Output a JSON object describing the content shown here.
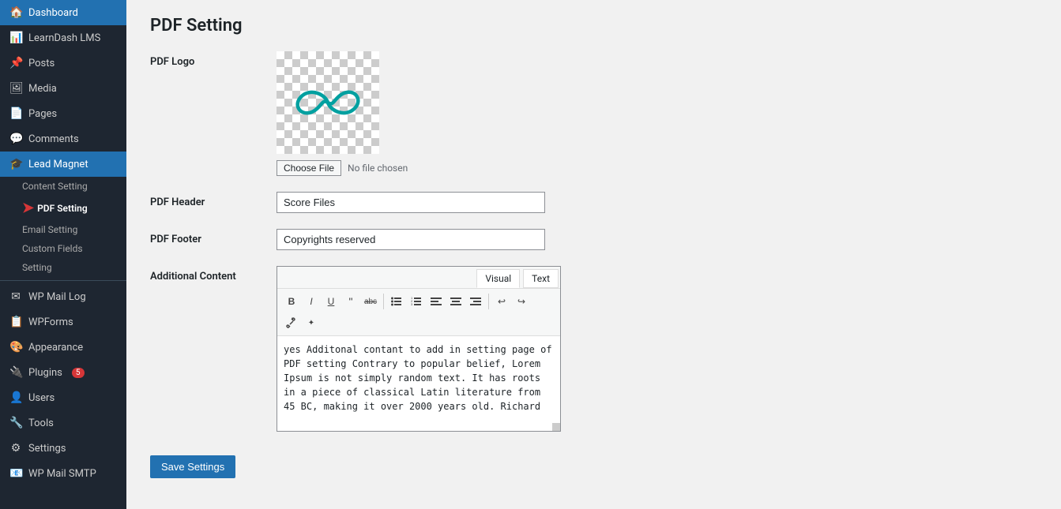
{
  "sidebar": {
    "items": [
      {
        "id": "dashboard",
        "label": "Dashboard",
        "icon": "🏠"
      },
      {
        "id": "learndash",
        "label": "LearnDash LMS",
        "icon": "📊"
      },
      {
        "id": "posts",
        "label": "Posts",
        "icon": "📌"
      },
      {
        "id": "media",
        "label": "Media",
        "icon": "🖼"
      },
      {
        "id": "pages",
        "label": "Pages",
        "icon": "📄"
      },
      {
        "id": "comments",
        "label": "Comments",
        "icon": "💬"
      },
      {
        "id": "lead-magnet",
        "label": "Lead Magnet",
        "icon": "🎓",
        "active": true
      }
    ],
    "submenu": [
      {
        "id": "content-setting",
        "label": "Content Setting"
      },
      {
        "id": "pdf-setting",
        "label": "PDF Setting",
        "active": true
      },
      {
        "id": "email-setting",
        "label": "Email Setting"
      },
      {
        "id": "custom-fields",
        "label": "Custom Fields"
      },
      {
        "id": "setting",
        "label": "Setting"
      }
    ],
    "bottom_items": [
      {
        "id": "wp-mail-log",
        "label": "WP Mail Log",
        "icon": "✉"
      },
      {
        "id": "wpforms",
        "label": "WPForms",
        "icon": "📋"
      },
      {
        "id": "appearance",
        "label": "Appearance",
        "icon": "🎨"
      },
      {
        "id": "plugins",
        "label": "Plugins",
        "icon": "🔌",
        "badge": "5"
      },
      {
        "id": "users",
        "label": "Users",
        "icon": "👤"
      },
      {
        "id": "tools",
        "label": "Tools",
        "icon": "🔧"
      },
      {
        "id": "settings",
        "label": "Settings",
        "icon": "⚙"
      },
      {
        "id": "wp-mail-smtp",
        "label": "WP Mail SMTP",
        "icon": "📧"
      }
    ]
  },
  "page": {
    "title": "PDF Setting"
  },
  "form": {
    "logo_label": "PDF Logo",
    "choose_file_label": "Choose File",
    "no_file_text": "No file chosen",
    "header_label": "PDF Header",
    "header_value": "Score Files",
    "footer_label": "PDF Footer",
    "footer_value": "Copyrights reserved",
    "additional_content_label": "Additional Content",
    "visual_tab": "Visual",
    "text_tab": "Text",
    "editor_content": "yes Additonal contant to add in setting page of PDF setting Contrary to popular belief, Lorem Ipsum is not simply random text. It has roots in a piece of classical Latin literature from 45 BC, making it over 2000 years old. Richard",
    "save_button": "Save Settings",
    "toolbar_buttons": [
      {
        "id": "bold",
        "symbol": "B",
        "title": "Bold"
      },
      {
        "id": "italic",
        "symbol": "I",
        "title": "Italic"
      },
      {
        "id": "underline",
        "symbol": "U",
        "title": "Underline"
      },
      {
        "id": "blockquote",
        "symbol": "❝",
        "title": "Blockquote"
      },
      {
        "id": "strikethrough",
        "symbol": "abc̶",
        "title": "Strikethrough"
      },
      {
        "id": "bullet-list",
        "symbol": "☰",
        "title": "Unordered List"
      },
      {
        "id": "ordered-list",
        "symbol": "≡",
        "title": "Ordered List"
      },
      {
        "id": "align-left",
        "symbol": "≡",
        "title": "Align Left"
      },
      {
        "id": "align-center",
        "symbol": "≡",
        "title": "Align Center"
      },
      {
        "id": "align-right",
        "symbol": "≡",
        "title": "Align Right"
      },
      {
        "id": "undo",
        "symbol": "↩",
        "title": "Undo"
      },
      {
        "id": "redo",
        "symbol": "↪",
        "title": "Redo"
      },
      {
        "id": "link",
        "symbol": "🔗",
        "title": "Insert Link"
      },
      {
        "id": "more",
        "symbol": "✦",
        "title": "More"
      }
    ]
  }
}
